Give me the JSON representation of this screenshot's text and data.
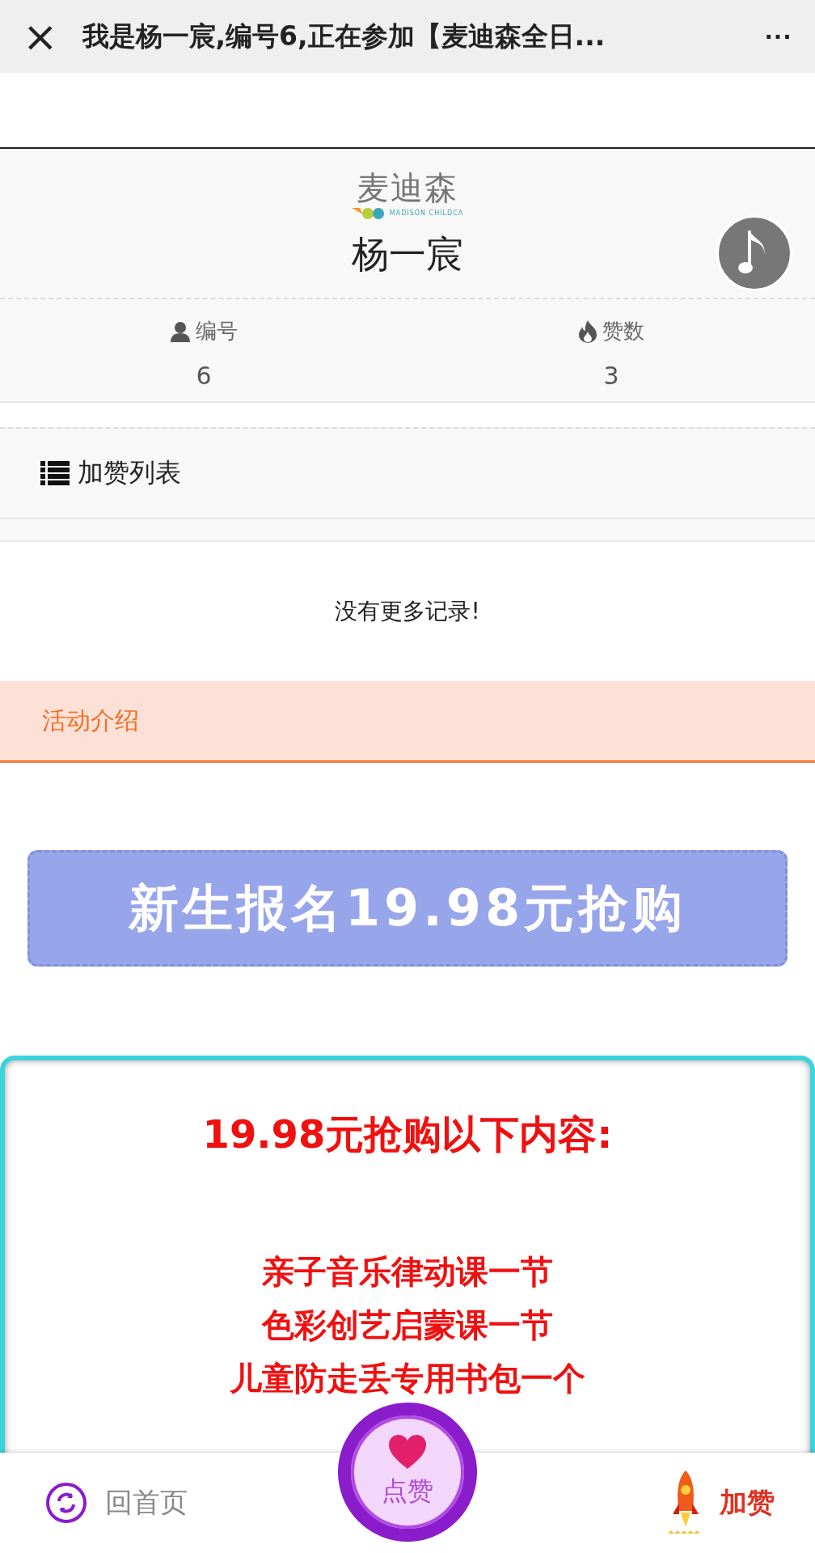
{
  "top_bar": {
    "close": "×",
    "title": "我是杨一宸,编号6,正在参加【麦迪森全日...",
    "more": "···"
  },
  "profile": {
    "logo": {
      "name": "麦迪森",
      "tagline": "MADISON CHILDCA"
    },
    "name": "杨一宸",
    "music_on": true
  },
  "stats": [
    {
      "kind": "person",
      "label": "编号",
      "value": "6"
    },
    {
      "kind": "fire",
      "label": "赞数",
      "value": "3"
    }
  ],
  "like_list": {
    "title": "加赞列表",
    "empty": "没有更多记录!"
  },
  "tabs": [
    {
      "label": "活动介绍",
      "selected": true
    }
  ],
  "banner": "新生报名19.98元抢购",
  "offer": {
    "title": "19.98元抢购以下内容:",
    "items": [
      "亲子音乐律动课一节",
      "色彩创艺启蒙课一节",
      "儿童防走丢专用书包一个"
    ]
  },
  "bottom_bar": {
    "home": "回首页",
    "like": "点赞",
    "boost": "加赞"
  }
}
